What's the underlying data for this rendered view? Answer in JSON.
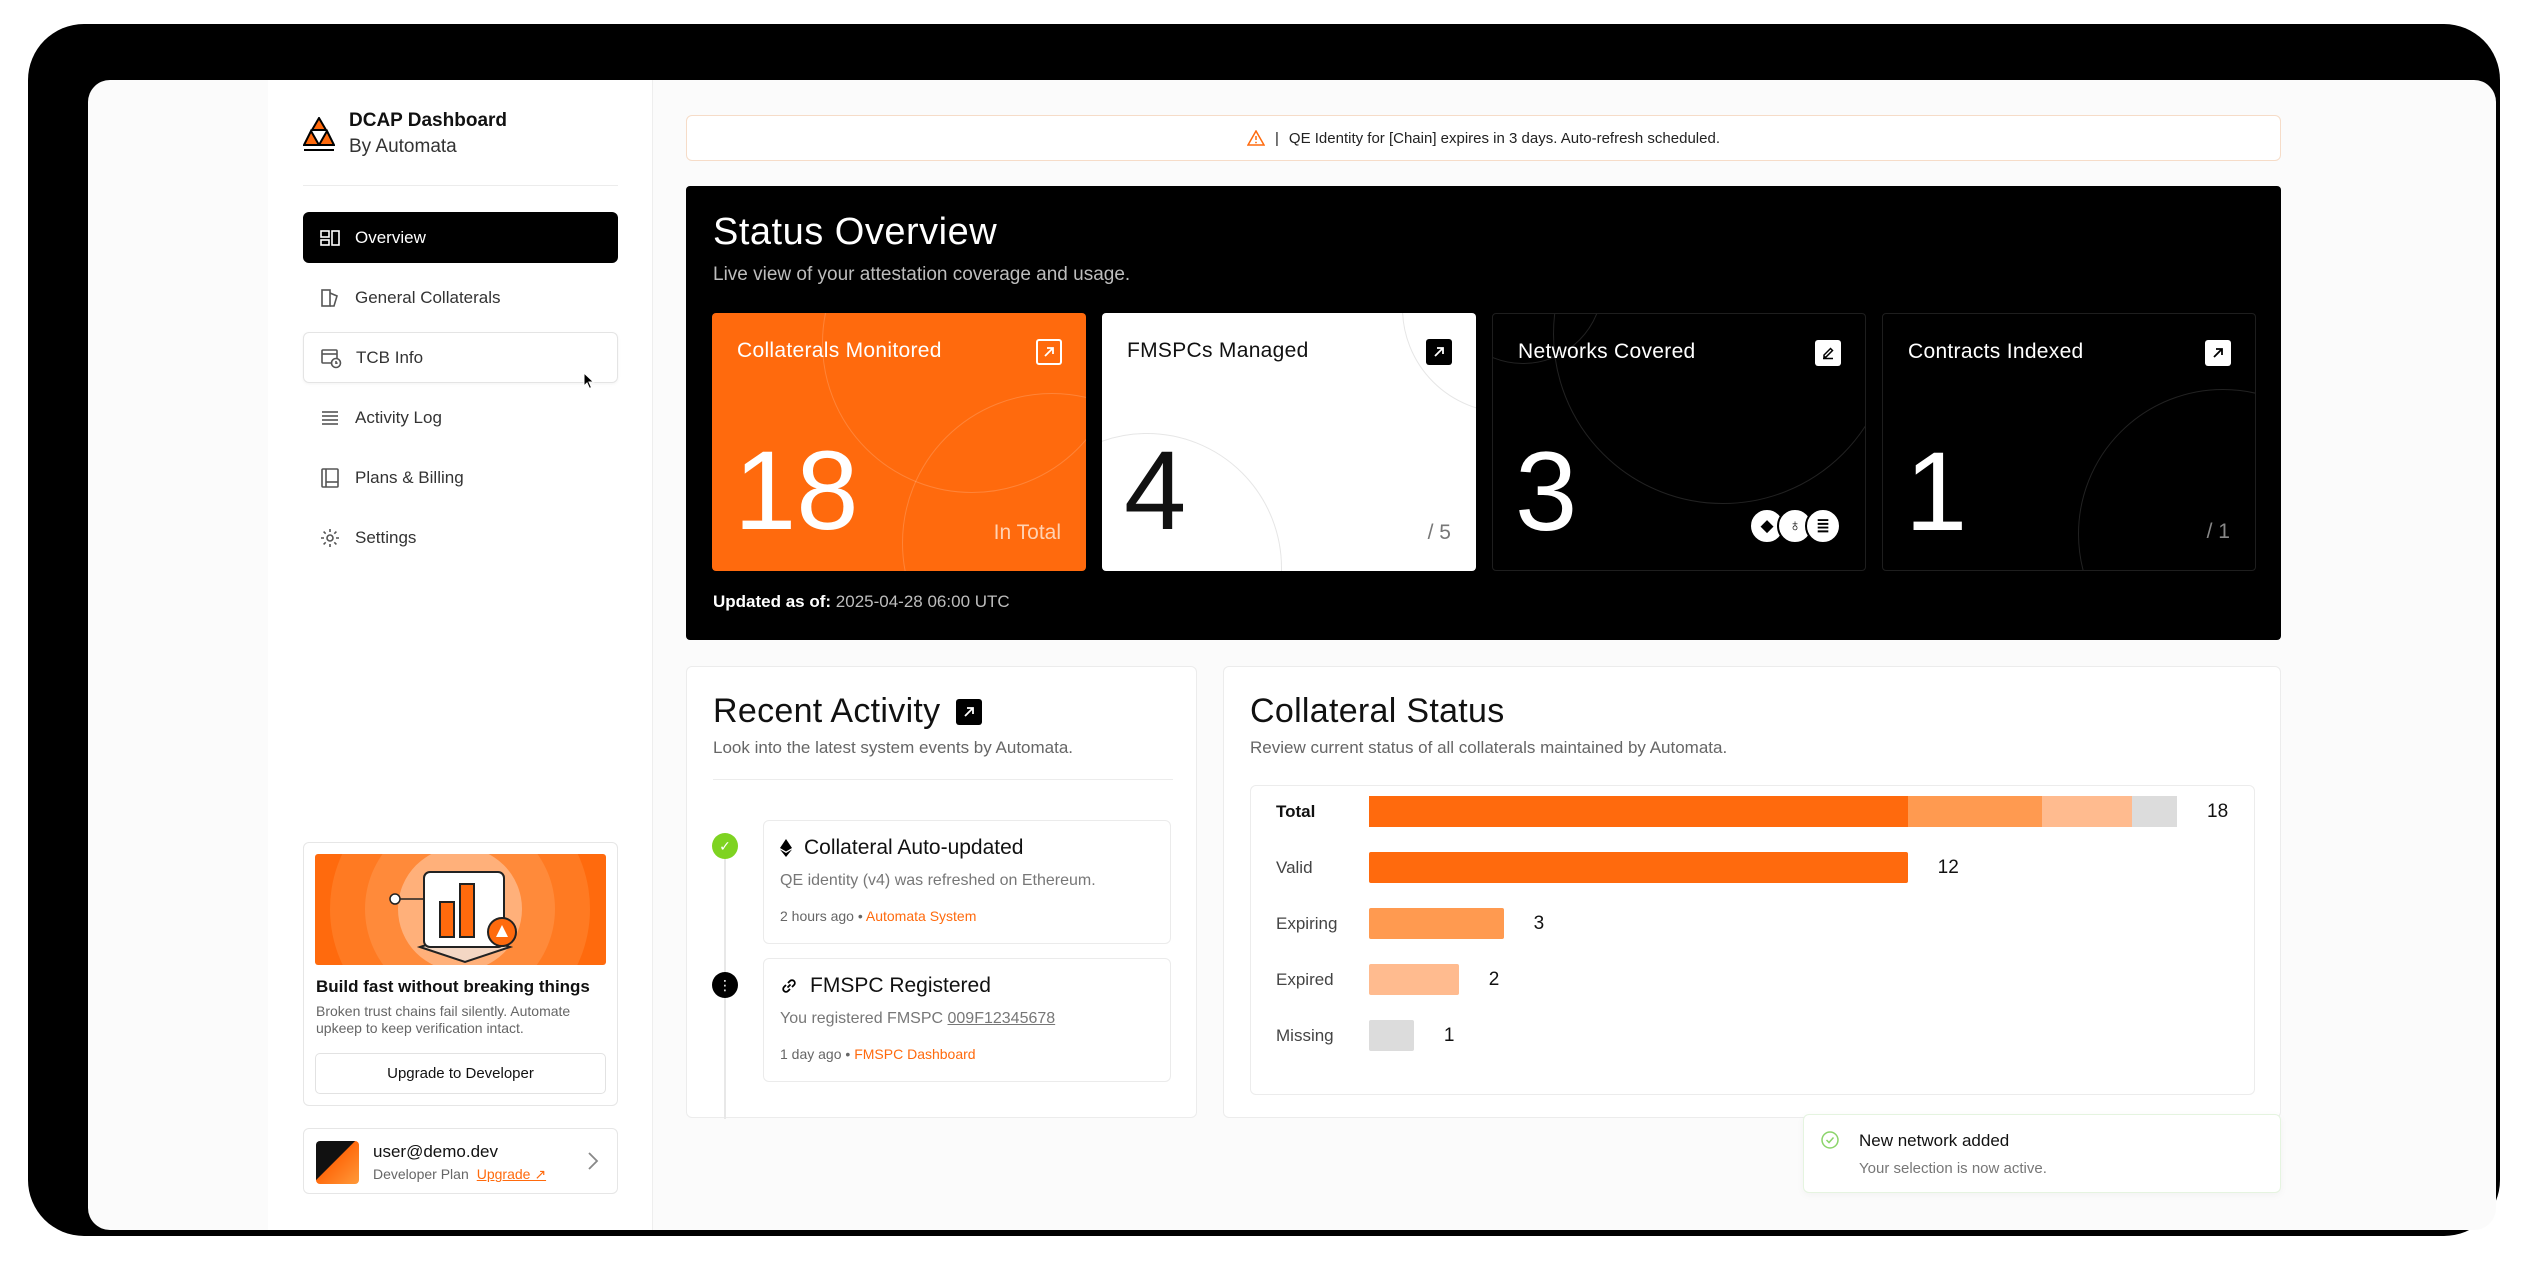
{
  "brand": {
    "title": "DCAP Dashboard",
    "subtitle": "By Automata"
  },
  "nav": [
    {
      "label": "Overview",
      "icon": "overview-icon",
      "active": true
    },
    {
      "label": "General Collaterals",
      "icon": "collaterals-icon"
    },
    {
      "label": "TCB Info",
      "icon": "tcb-icon"
    },
    {
      "label": "Activity Log",
      "icon": "list-icon"
    },
    {
      "label": "Plans & Billing",
      "icon": "book-icon"
    },
    {
      "label": "Settings",
      "icon": "gear-icon"
    }
  ],
  "promo": {
    "title": "Build fast without breaking things",
    "text": "Broken trust chains fail silently. Automate upkeep to keep verification intact.",
    "button": "Upgrade to Developer"
  },
  "user": {
    "email": "user@demo.dev",
    "plan": "Developer Plan",
    "upgrade": "Upgrade ↗"
  },
  "alert": {
    "separator": "|",
    "text": "QE Identity for [Chain] expires in 3 days. Auto-refresh scheduled."
  },
  "status": {
    "title": "Status Overview",
    "subtitle": "Live view of your attestation coverage and usage.",
    "cards": [
      {
        "label": "Collaterals Monitored",
        "value": "18",
        "foot": "In Total"
      },
      {
        "label": "FMSPCs Managed",
        "value": "4",
        "foot": "/ 5"
      },
      {
        "label": "Networks Covered",
        "value": "3"
      },
      {
        "label": "Contracts Indexed",
        "value": "1",
        "foot": "/ 1"
      }
    ],
    "updated_label": "Updated as of:",
    "updated_value": "2025-04-28 06:00 UTC"
  },
  "recent": {
    "title": "Recent Activity",
    "subtitle": "Look into the latest system events by Automata.",
    "events": [
      {
        "title": "Collateral Auto-updated",
        "desc": "QE identity (v4) was refreshed on Ethereum.",
        "time": "2 hours ago",
        "source": "Automata System"
      },
      {
        "title": "FMSPC Registered",
        "desc_prefix": "You registered FMSPC",
        "desc_code": "009F12345678",
        "time": "1 day ago",
        "source": "FMSPC Dashboard"
      }
    ]
  },
  "collateral": {
    "title": "Collateral Status",
    "subtitle": "Review current status of all collaterals maintained by Automata.",
    "colors": {
      "valid": "#ff6a0d",
      "expiring": "#ff9a50",
      "expired": "#ffbb8f",
      "missing": "#dcdcdc"
    }
  },
  "chart_data": {
    "type": "bar",
    "orientation": "horizontal",
    "categories": [
      "Total",
      "Valid",
      "Expiring",
      "Expired",
      "Missing"
    ],
    "values": [
      18,
      12,
      3,
      2,
      1
    ],
    "stacked_total": {
      "Valid": 12,
      "Expiring": 3,
      "Expired": 2,
      "Missing": 1
    }
  },
  "toast": {
    "title": "New network added",
    "subtitle": "Your selection is now active."
  }
}
